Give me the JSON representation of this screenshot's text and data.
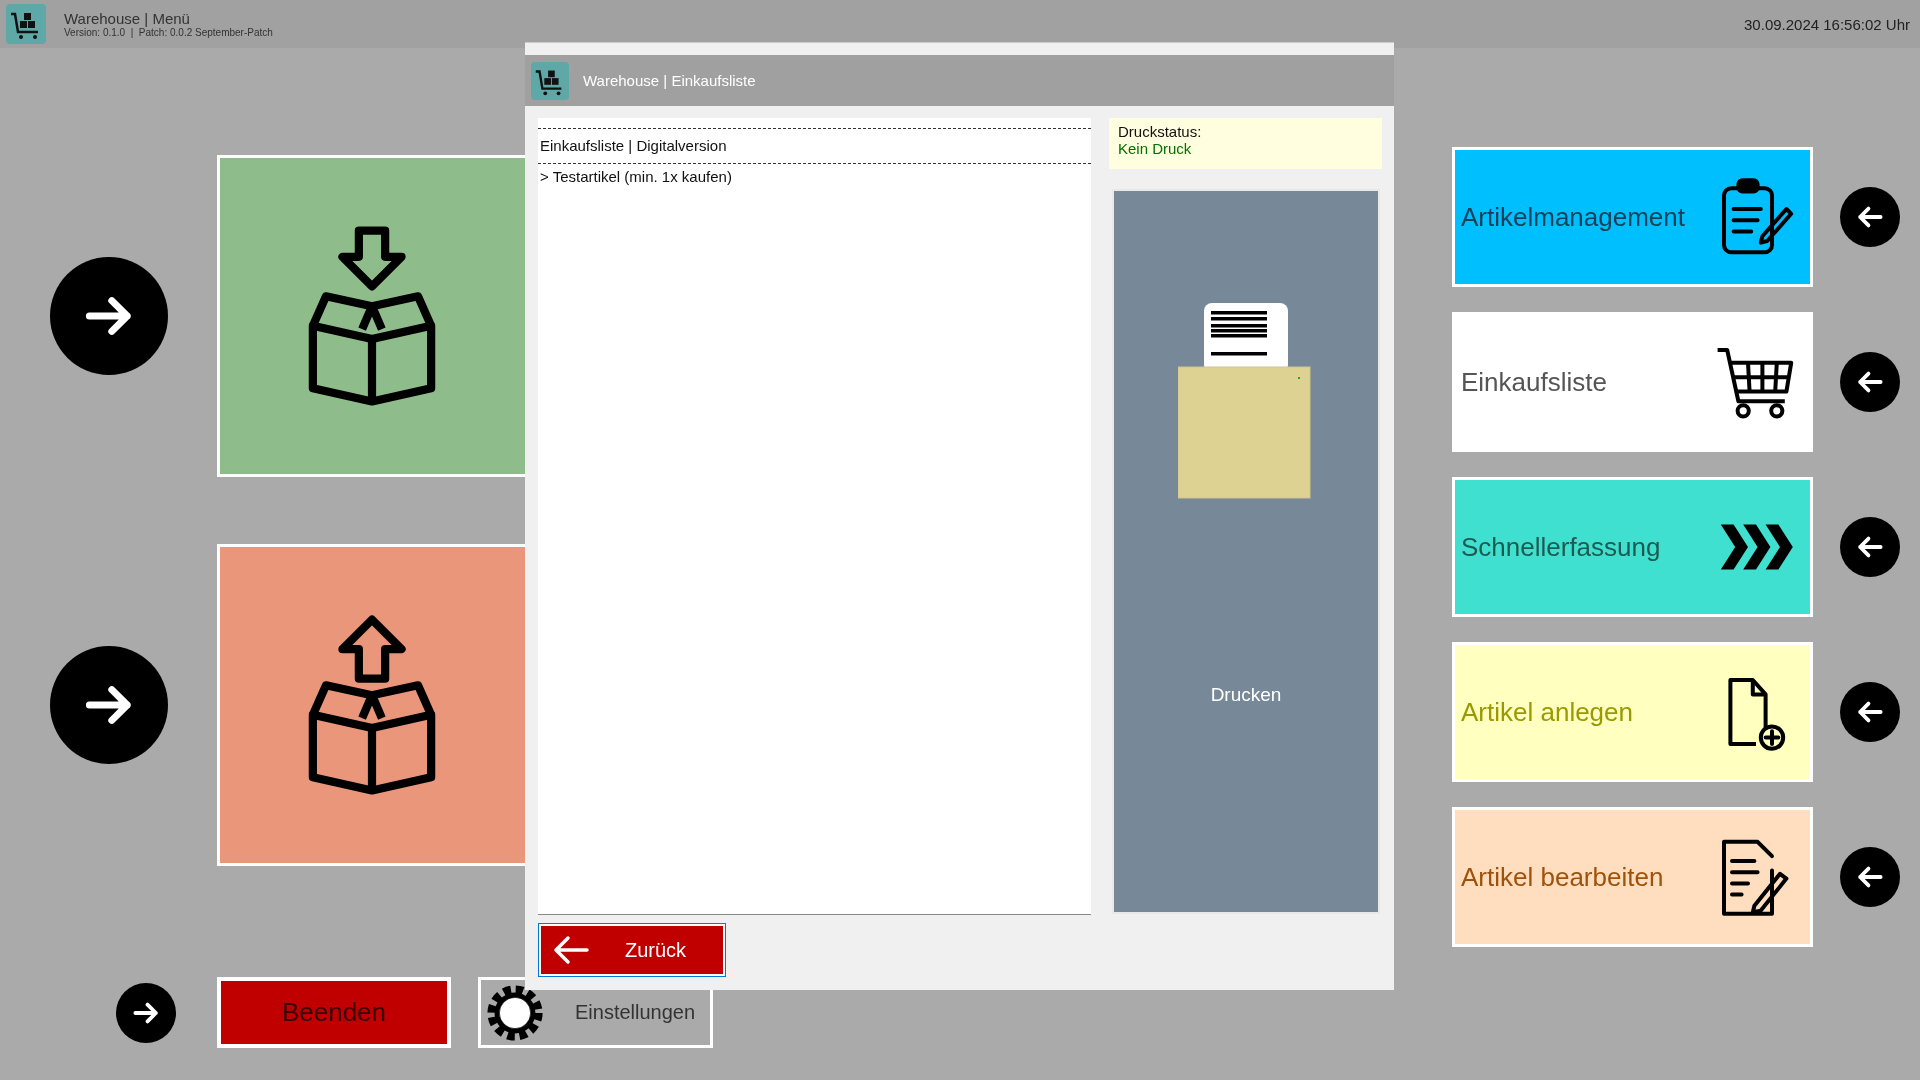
{
  "main_window": {
    "title": "Warehouse | Menü",
    "version": "Version: 0.1.0  |  Patch: 0.0.2 September-Patch",
    "clock": "30.09.2024 16:56:02 Uhr"
  },
  "left_tiles": [
    {
      "kind": "inbound",
      "color": "#8fbc8b"
    },
    {
      "kind": "outbound",
      "color": "#e9967a"
    }
  ],
  "bottom_buttons": [
    {
      "kind": "quit",
      "label": "Beenden"
    },
    {
      "kind": "settings",
      "label": "Einstellungen"
    }
  ],
  "right_tiles": [
    {
      "kind": "manage",
      "label": "Artikelmanagement",
      "color": "#00bfff"
    },
    {
      "kind": "list",
      "label": "Einkaufsliste",
      "color": "#ffffff"
    },
    {
      "kind": "quick",
      "label": "Schnellerfassung",
      "color": "#40e0d0"
    },
    {
      "kind": "create",
      "label": "Artikel anlegen",
      "color": "#ffffc0"
    },
    {
      "kind": "edit",
      "label": "Artikel bearbeiten",
      "color": "#ffdec0"
    }
  ],
  "dialog": {
    "title": "Warehouse | Einkaufsliste",
    "list_lines": [
      "Einkaufsliste | Digitalversion",
      "> Testartikel (min. 1x kaufen)"
    ],
    "print_status": {
      "label": "Druckstatus:",
      "value": "Kein Druck"
    },
    "print_button": "Drucken",
    "back_button": "Zurück"
  }
}
